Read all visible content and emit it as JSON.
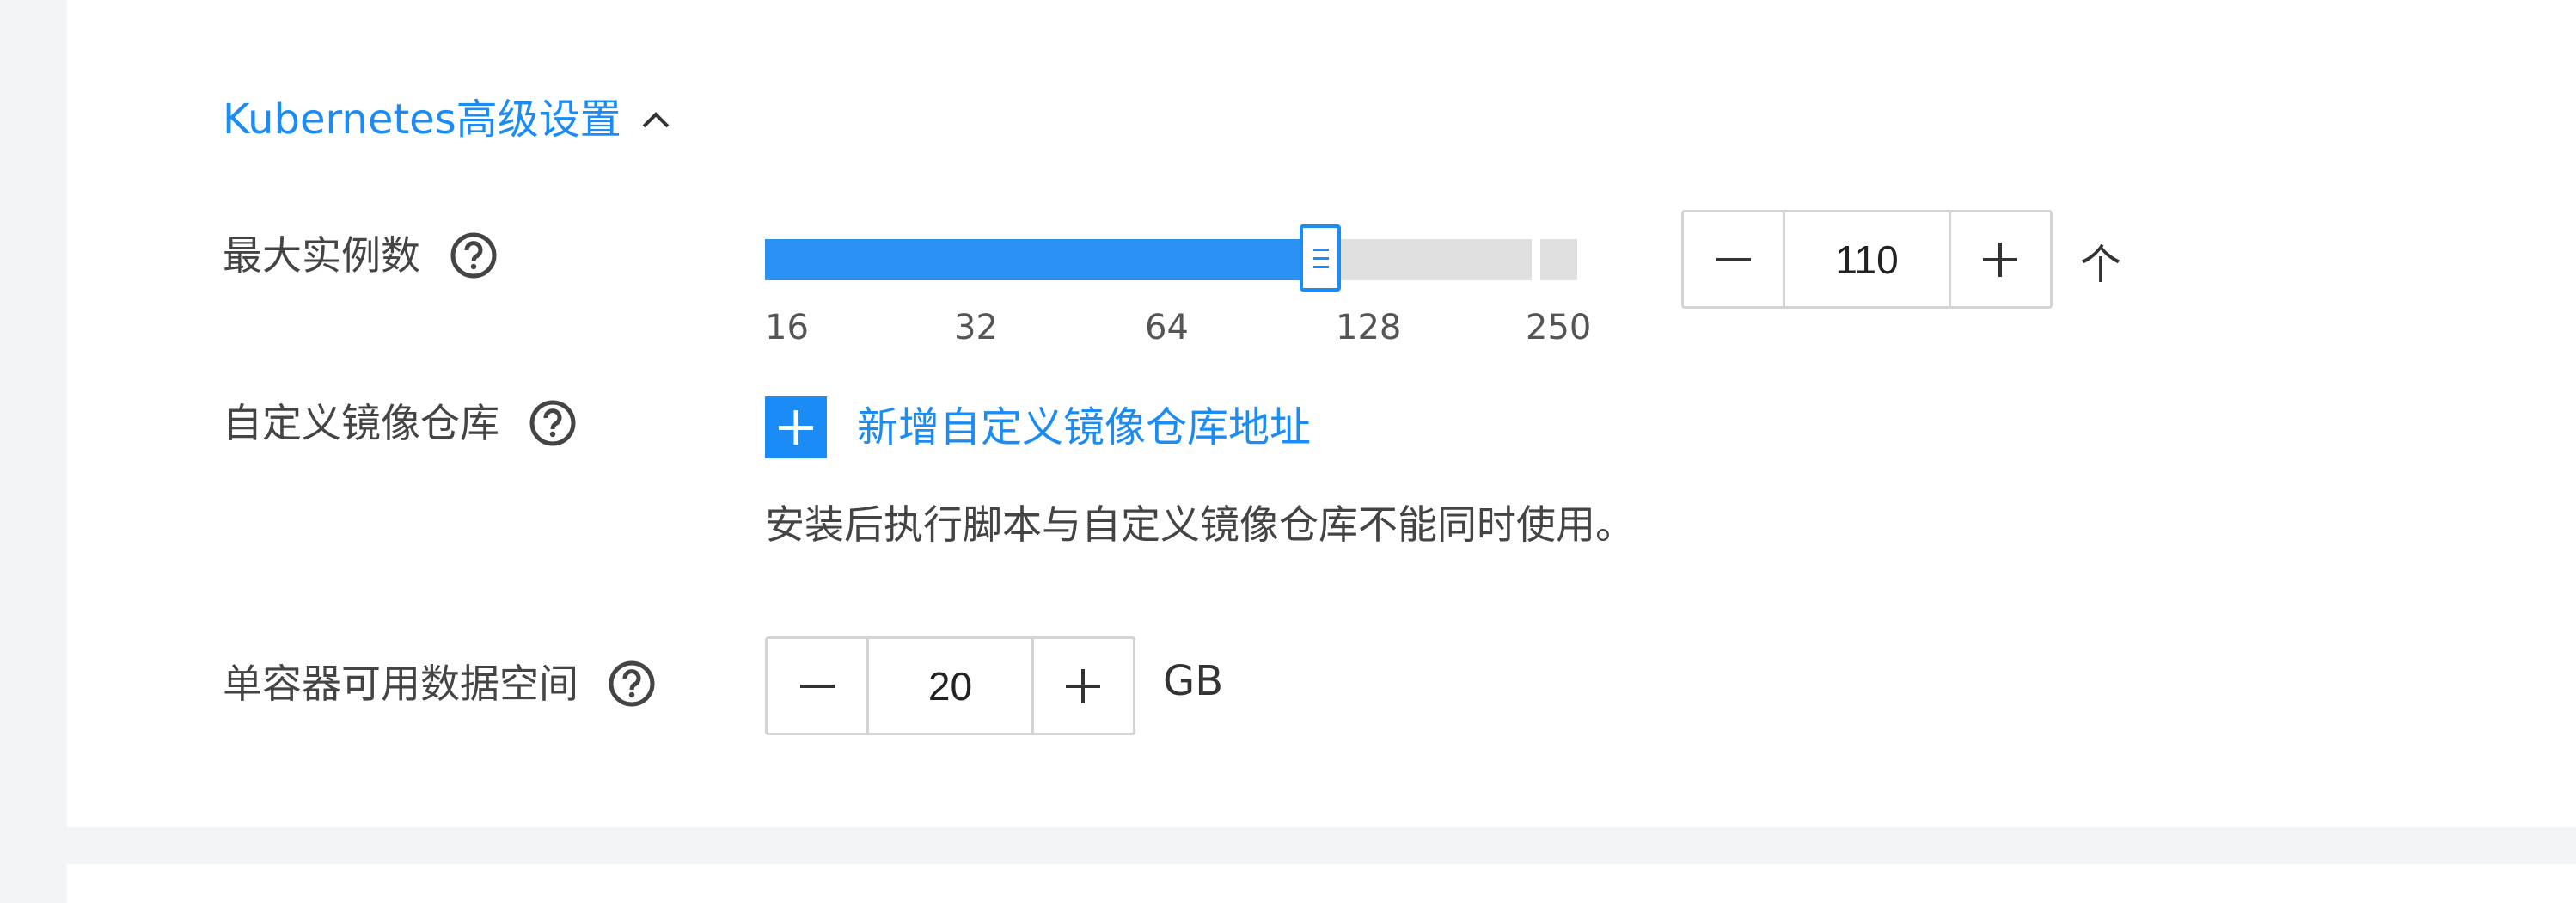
{
  "section": {
    "title": "Kubernetes高级设置",
    "chevron_icon": "chevron-up-icon"
  },
  "max_instances": {
    "label": "最大实例数",
    "help_icon": "help-circle-icon",
    "slider_ticks": [
      "16",
      "32",
      "64",
      "128",
      "250"
    ],
    "slider_level_fraction": 0.68,
    "value": "110",
    "unit": "个"
  },
  "registry": {
    "label": "自定义镜像仓库",
    "help_icon": "help-circle-icon",
    "add_label": "新增自定义镜像仓库地址",
    "note": "安装后执行脚本与自定义镜像仓库不能同时使用。"
  },
  "storage": {
    "label": "单容器可用数据空间",
    "help_icon": "help-circle-icon",
    "value": "20",
    "unit": "GB"
  },
  "colors": {
    "accent": "#1b8cf5",
    "track": "#e0e0e0",
    "background": "#f3f4f6"
  }
}
